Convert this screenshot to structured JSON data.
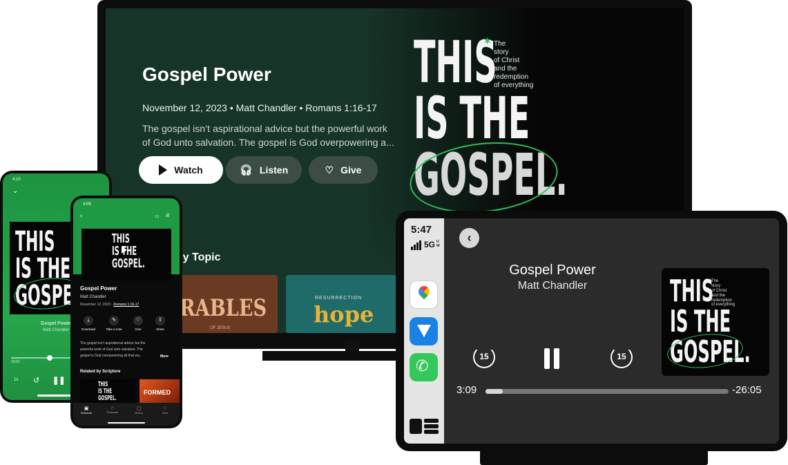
{
  "colors": {
    "accent_green": "#2ebd59",
    "tv_bg": "#173428",
    "car_bg": "#2b2b2b",
    "phone_green": "#24a84a"
  },
  "cover_art": {
    "big_lines": [
      "THIS",
      "IS THE",
      "GOSPEL."
    ],
    "small_lines": [
      "The",
      "story",
      "of Christ",
      "and the",
      "redemption",
      "of everything"
    ]
  },
  "tv": {
    "title": "Gospel Power",
    "meta": "November 12, 2023 • Matt Chandler • Romans 1:16-17",
    "description_line1": "The gospel isn’t aspirational advice but the powerful work",
    "description_line2": "of God unto salvation. The gospel is God overpowering a...",
    "watch_label": "Watch",
    "listen_label": "Listen",
    "give_label": "Give",
    "section_title": "l by Topic",
    "tile1_text": "RABLES",
    "tile1_sub": "OF JESUS",
    "tile2_top": "RESURRECTION",
    "tile2_word": "hope"
  },
  "car": {
    "time": "5:47",
    "network": "5G",
    "network_sup": "UW",
    "title": "Gospel Power",
    "artist": "Matt Chandler",
    "skip_back": "15",
    "skip_fwd": "15",
    "elapsed": "3:09",
    "remaining": "-26:05",
    "progress": 0.07
  },
  "phone_back": {
    "time": "4:10",
    "title": "Gospel Power",
    "artist": "Matt Chandler",
    "elapsed": "10:02",
    "speed": "1x"
  },
  "phone_front": {
    "time": "4:09",
    "title": "Gospel Power",
    "artist": "Matt Chandler",
    "meta_date": "November 12, 2023 - ",
    "meta_ref": "Romans 1:16-17",
    "actions": [
      "Download",
      "Take a note",
      "Give",
      "Share"
    ],
    "desc_line1": "The gospel isn’t aspirational advice but the",
    "desc_line2": "powerful work of God unto salvation. The",
    "desc_line3": "gospel is God overpowering all that wa...",
    "more_label": "More",
    "related_title": "Related by Scripture",
    "formed_text": "FORMED",
    "tabs": [
      "Sermons",
      "Podcasts",
      "Videos",
      "Give"
    ]
  }
}
